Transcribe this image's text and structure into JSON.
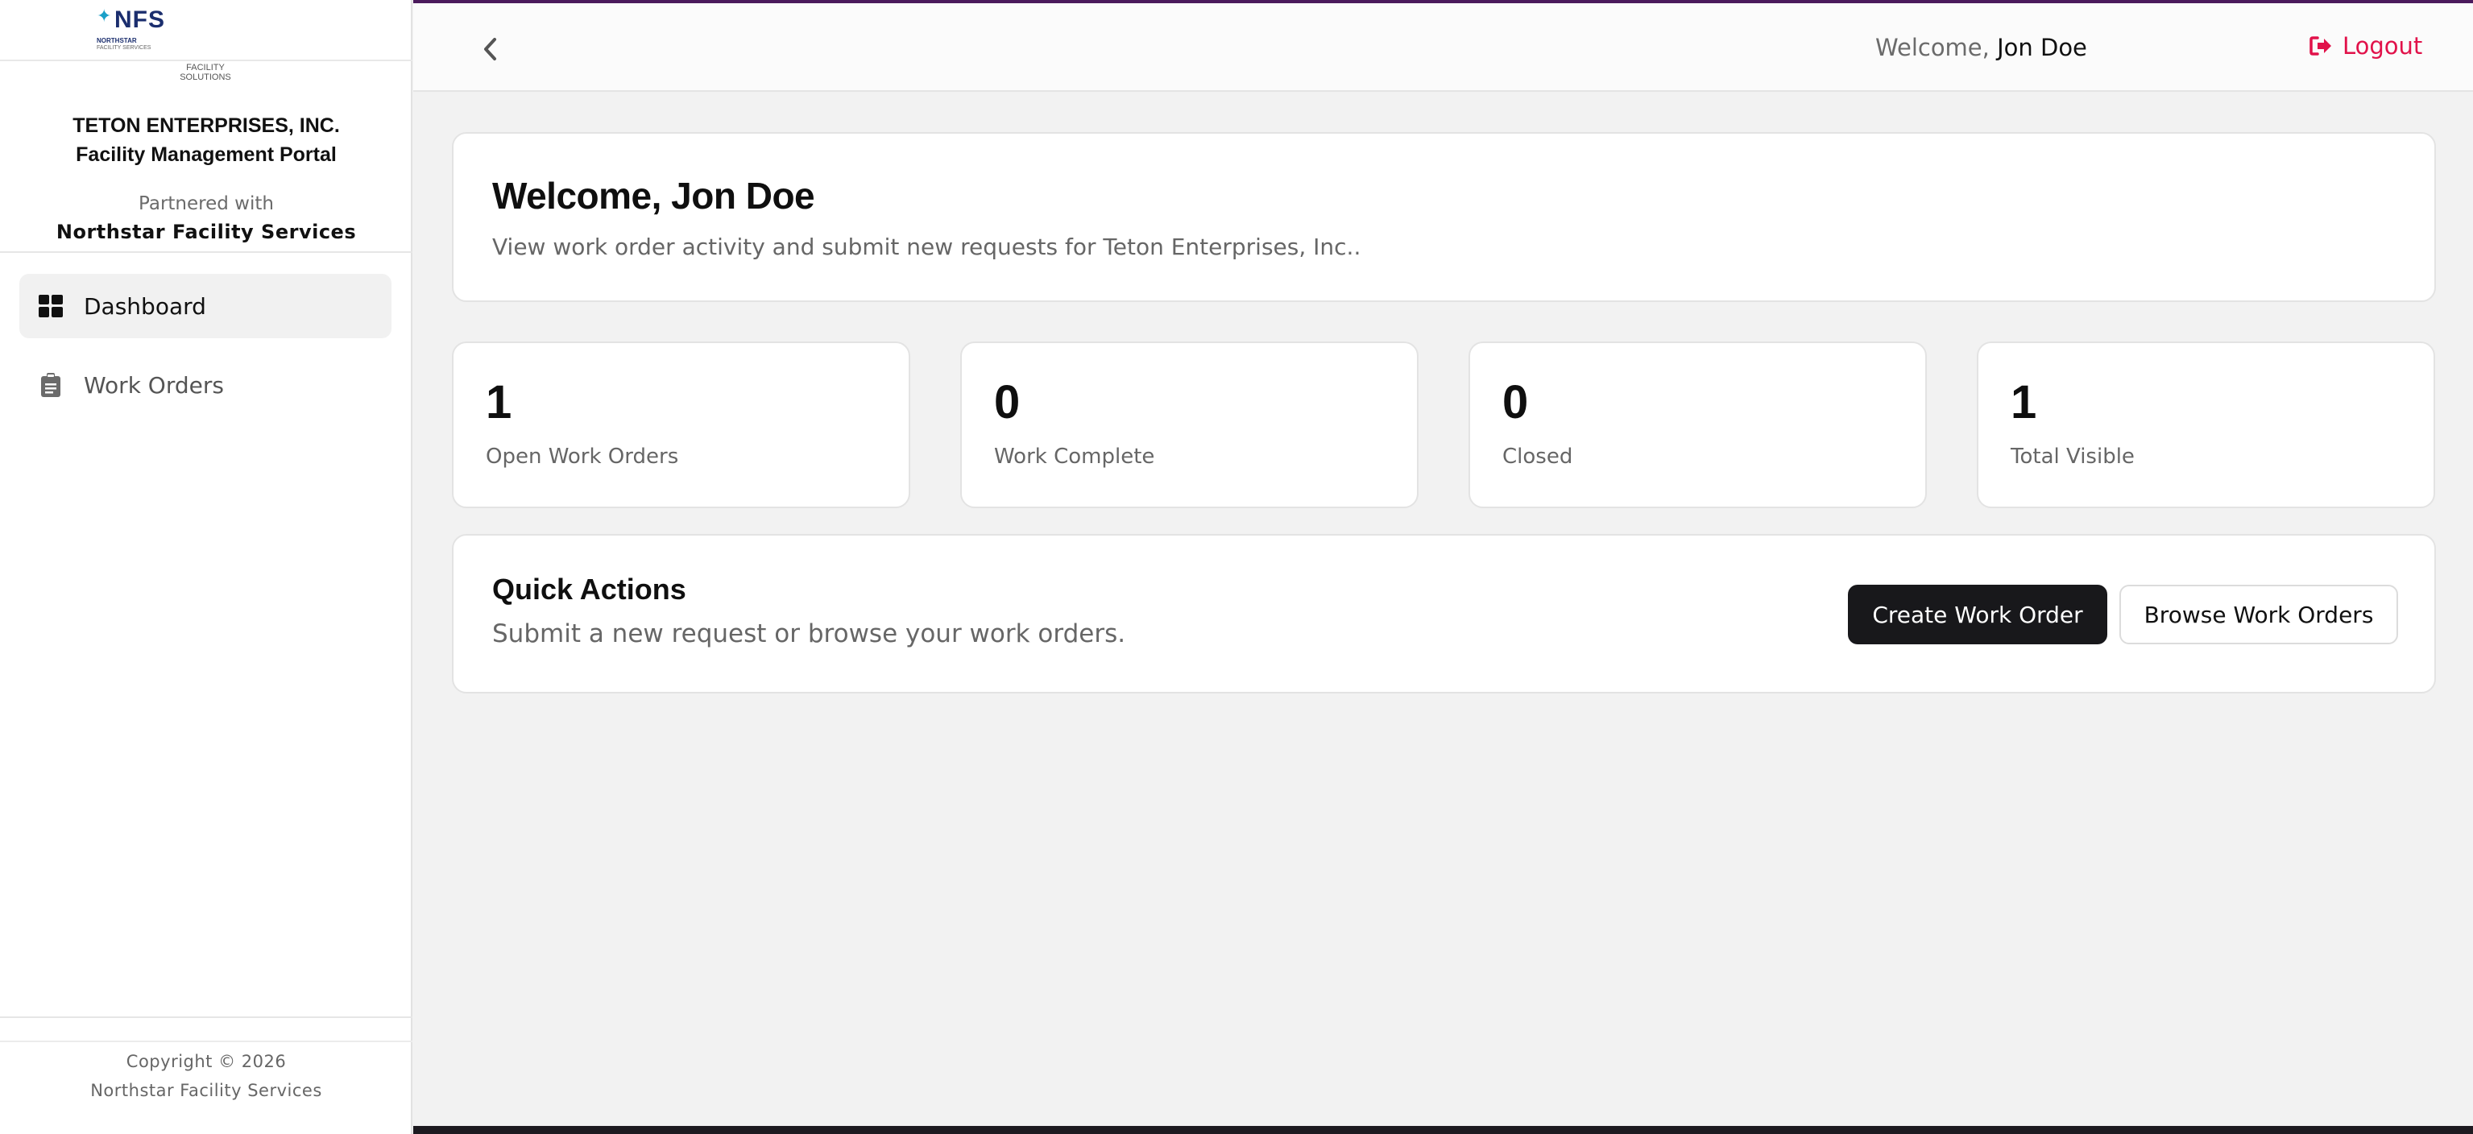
{
  "colors": {
    "topbar_accent": "#4b1a5c",
    "logout": "#e1124a",
    "primary_button": "#18181b",
    "logo_navy": "#1b2e6e",
    "logo_star": "#1aa0c8"
  },
  "brand": {
    "logo_text": "NFS",
    "logo_sub1": "NORTHSTAR",
    "logo_sub2": "FACILITY SERVICES",
    "logo_tagline": "FACILITY SOLUTIONS"
  },
  "sidebar": {
    "org_name": "TETON ENTERPRISES, INC.",
    "portal_name": "Facility Management Portal",
    "partnered_label": "Partnered with",
    "partner_name": "Northstar Facility Services",
    "items": [
      {
        "label": "Dashboard",
        "icon": "dashboard-grid-icon",
        "active": true
      },
      {
        "label": "Work Orders",
        "icon": "clipboard-icon",
        "active": false
      }
    ],
    "footer": {
      "copyright": "Copyright © 2026",
      "company": "Northstar Facility Services"
    }
  },
  "topbar": {
    "back_icon": "chevron-left-icon",
    "welcome_prefix": "Welcome,",
    "user_name": "Jon Doe",
    "logout_label": "Logout",
    "logout_icon": "sign-out-icon"
  },
  "welcome_card": {
    "title": "Welcome, Jon Doe",
    "subtitle": "View work order activity and submit new requests for Teton Enterprises, Inc.."
  },
  "stats": [
    {
      "value": "1",
      "label": "Open Work Orders"
    },
    {
      "value": "0",
      "label": "Work Complete"
    },
    {
      "value": "0",
      "label": "Closed"
    },
    {
      "value": "1",
      "label": "Total Visible"
    }
  ],
  "quick_actions": {
    "title": "Quick Actions",
    "subtitle": "Submit a new request or browse your work orders.",
    "primary_label": "Create Work Order",
    "secondary_label": "Browse Work Orders"
  }
}
